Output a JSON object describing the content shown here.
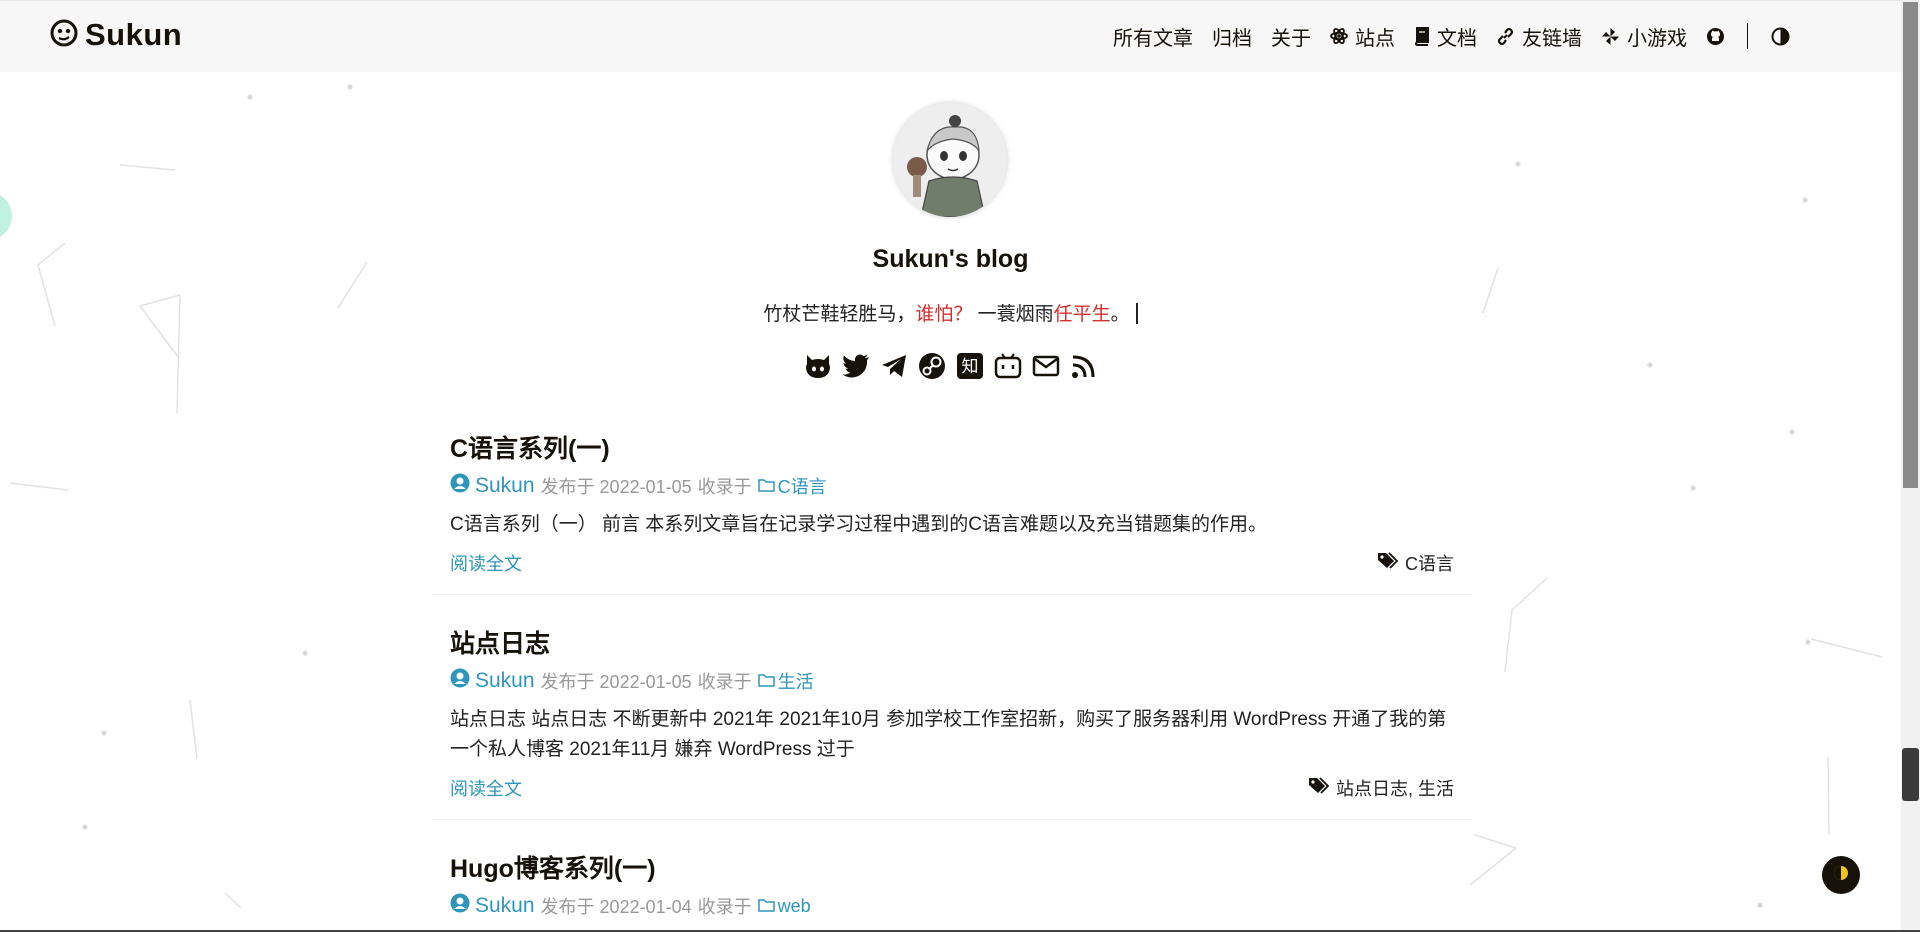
{
  "site": {
    "logo_text": "Sukun",
    "title": "Sukun's blog"
  },
  "nav": {
    "items": [
      {
        "label": "所有文章",
        "icon": ""
      },
      {
        "label": "归档",
        "icon": ""
      },
      {
        "label": "关于",
        "icon": ""
      },
      {
        "label": "站点",
        "icon": "atom-icon"
      },
      {
        "label": "文档",
        "icon": "book-icon"
      },
      {
        "label": "友链墙",
        "icon": "link-icon"
      },
      {
        "label": "小游戏",
        "icon": "pinwheel-icon"
      }
    ],
    "github_icon": "github-icon",
    "theme_icon": "contrast-icon"
  },
  "subtitle": {
    "part1": "竹杖芒鞋轻胜马，",
    "part2": "谁怕？",
    "part3": " 一蓑烟雨",
    "part4": "任平生",
    "part5": "。"
  },
  "socials": [
    "github-icon",
    "twitter-icon",
    "telegram-icon",
    "steam-icon",
    "zhihu-icon",
    "bilibili-icon",
    "mail-icon",
    "rss-icon"
  ],
  "posts": [
    {
      "title": "C语言系列(一)",
      "author": "Sukun",
      "published": "发布于 2022-01-05",
      "collected": "收录于",
      "category": "C语言",
      "summary": "C语言系列（一） 前言 本系列文章旨在记录学习过程中遇到的C语言难题以及充当错题集的作用。",
      "read_more": "阅读全文",
      "tags": "C语言"
    },
    {
      "title": "站点日志",
      "author": "Sukun",
      "published": "发布于 2022-01-05",
      "collected": "收录于",
      "category": "生活",
      "summary": "站点日志 站点日志 不断更新中 2021年 2021年10月 参加学校工作室招新，购买了服务器利用 WordPress 开通了我的第一个私人博客 2021年11月 嫌弃 WordPress 过于",
      "read_more": "阅读全文",
      "tags": "站点日志, 生活"
    },
    {
      "title": "Hugo博客系列(一)",
      "author": "Sukun",
      "published": "发布于 2022-01-04",
      "collected": "收录于",
      "category": "web"
    }
  ],
  "colors": {
    "accent": "#2d96bd",
    "highlight": "#d42e2e",
    "text": "#161209"
  }
}
